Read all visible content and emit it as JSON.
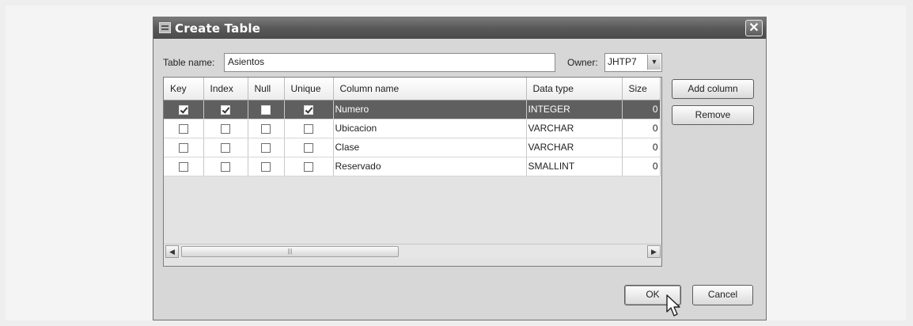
{
  "dialog": {
    "title": "Create Table",
    "close_glyph": "✕",
    "title_icon": "table-icon"
  },
  "form": {
    "table_name_label": "Table name:",
    "table_name_value": "Asientos",
    "owner_label": "Owner:",
    "owner_value": "JHTP7",
    "owner_arrow": "▼"
  },
  "table": {
    "headers": [
      "Key",
      "Index",
      "Null",
      "Unique",
      "Column name",
      "Data type",
      "Size"
    ],
    "rows": [
      {
        "key": true,
        "index": true,
        "null": false,
        "unique": true,
        "name": "Numero",
        "type": "INTEGER",
        "size": "0",
        "selected": true
      },
      {
        "key": false,
        "index": false,
        "null": false,
        "unique": false,
        "name": "Ubicacion",
        "type": "VARCHAR",
        "size": "0",
        "selected": false
      },
      {
        "key": false,
        "index": false,
        "null": false,
        "unique": false,
        "name": "Clase",
        "type": "VARCHAR",
        "size": "0",
        "selected": false
      },
      {
        "key": false,
        "index": false,
        "null": false,
        "unique": false,
        "name": "Reservado",
        "type": "SMALLINT",
        "size": "0",
        "selected": false
      }
    ],
    "scroll_left": "◀",
    "scroll_right": "▶",
    "scroll_grip": "|||"
  },
  "buttons": {
    "add_column": "Add column",
    "remove": "Remove",
    "ok": "OK",
    "cancel": "Cancel"
  },
  "colors": {
    "selected_row": "#5f5f5f",
    "titlebar": "#595959"
  }
}
